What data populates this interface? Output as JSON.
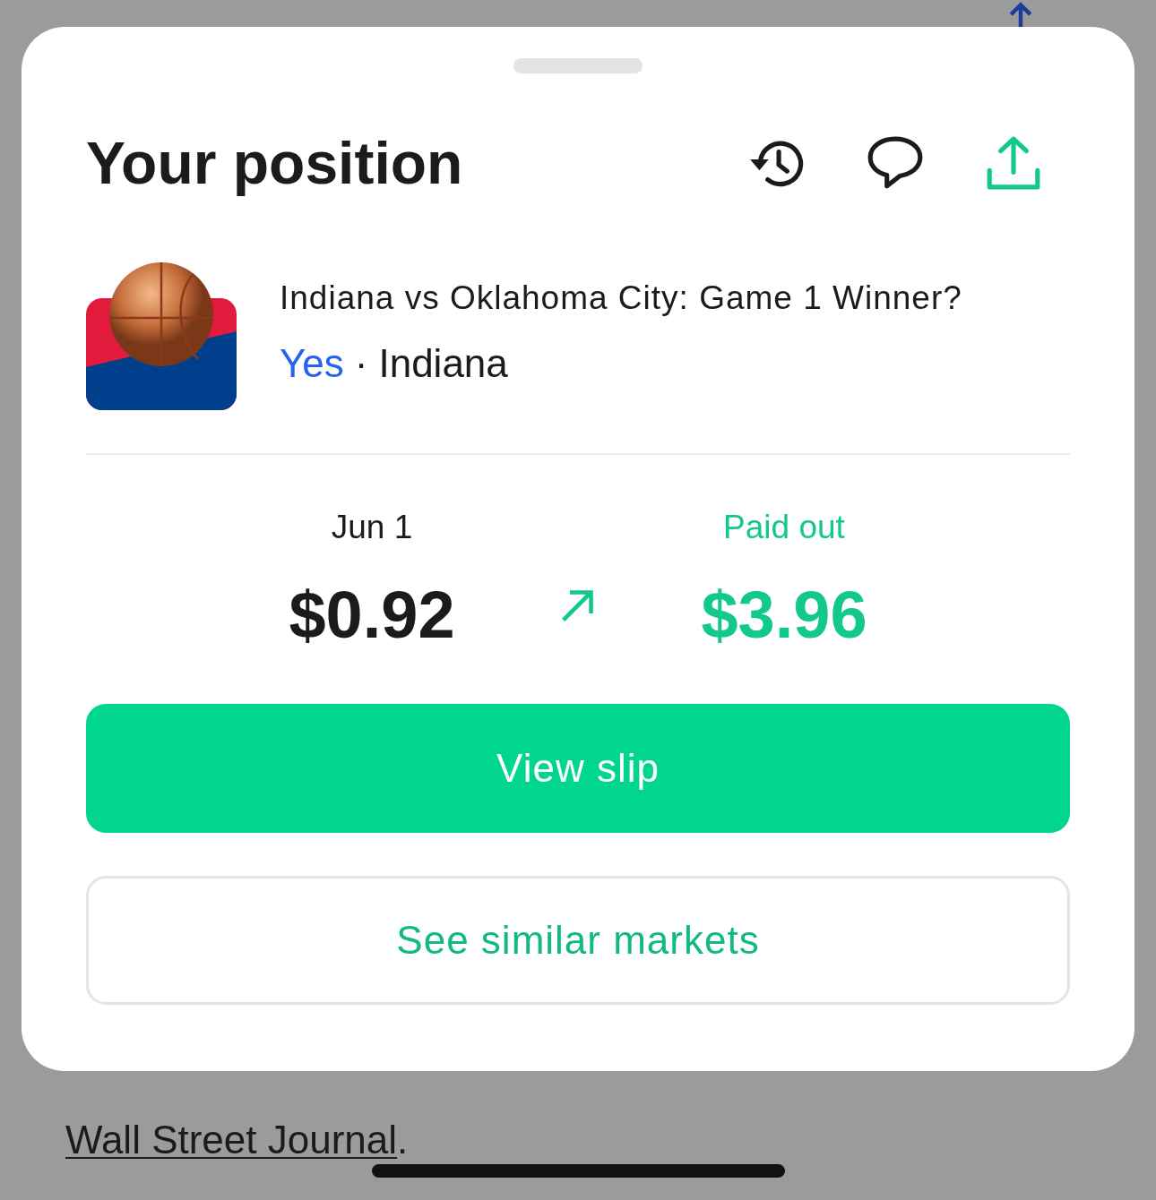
{
  "background": {
    "note": [
      {
        "kind": "link",
        "text": "Wall Street Journal"
      },
      {
        "kind": "text",
        "text": "."
      }
    ]
  },
  "sheet": {
    "title": "Your position",
    "market": {
      "question": "Indiana vs Oklahoma City: Game 1 Winner?",
      "side": "Yes",
      "separator": "·",
      "team": "Indiana"
    },
    "stats": [
      {
        "kind": "cost",
        "label": "Jun 1",
        "value": "$0.92"
      },
      {
        "kind": "payout",
        "label": "Paid out",
        "value": "$3.96"
      }
    ],
    "buttons": [
      {
        "kind": "primary",
        "label": "View slip"
      },
      {
        "kind": "secondary",
        "label": "See similar markets"
      }
    ]
  }
}
